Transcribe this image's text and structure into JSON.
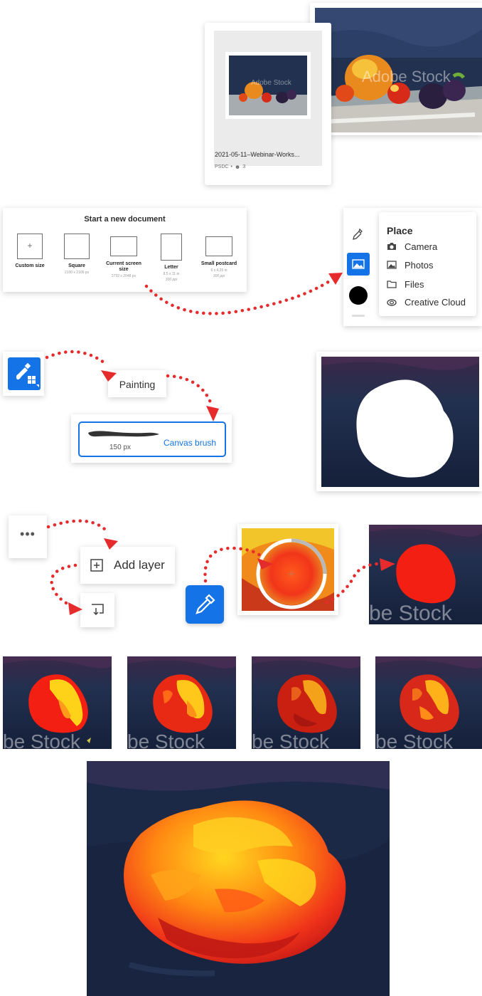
{
  "cloud_doc": {
    "thumbnail_watermark": "Adobe Stock",
    "filename": "2021-05-11–Webinar-Works...",
    "meta_type": "PSDC",
    "meta_shared_count": "3",
    "preview_watermark": "Adobe Stock"
  },
  "new_document": {
    "title": "Start a new document",
    "options": [
      {
        "label": "Custom size",
        "size": "",
        "resolution": ""
      },
      {
        "label": "Square",
        "size": "2100 x 2100 px",
        "resolution": ""
      },
      {
        "label": "Current screen size",
        "size": "2732 x 2048 px",
        "resolution": ""
      },
      {
        "label": "Letter",
        "size": "8.5 x 11 in",
        "resolution": "300 ppi"
      },
      {
        "label": "Small postcard",
        "size": "6 x 4.25 in",
        "resolution": "300 ppi"
      }
    ]
  },
  "place_menu": {
    "title": "Place",
    "items": [
      {
        "label": "Camera",
        "icon": "camera-icon"
      },
      {
        "label": "Photos",
        "icon": "photos-icon"
      },
      {
        "label": "Files",
        "icon": "folder-icon"
      },
      {
        "label": "Creative Cloud",
        "icon": "creative-cloud-icon"
      }
    ],
    "tool_icons": [
      "eyedropper-icon",
      "place-image-icon",
      "color-swatch"
    ]
  },
  "painting": {
    "tool_icon": "brush-tool-icon",
    "group_label": "Painting",
    "brush_size": "150 px",
    "brush_name": "Canvas brush"
  },
  "layers": {
    "more_icon": "more-options-icon",
    "add_layer_label": "Add layer",
    "merge_icon": "merge-down-icon",
    "eyedropper_icon": "eyedropper-icon"
  },
  "watermarks": {
    "row_fragment": "be Stock"
  },
  "colors": {
    "accent": "#1473e6",
    "arrow": "#e52b2b",
    "night_bg": "#1d2a45",
    "apple_red": "#f21f12",
    "apple_yellow": "#ffd21a"
  }
}
